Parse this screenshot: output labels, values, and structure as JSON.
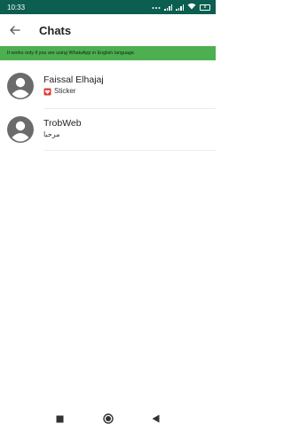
{
  "status_bar": {
    "time": "10:33",
    "battery": "8"
  },
  "header": {
    "title": "Chats",
    "back_icon": "arrow-back-icon"
  },
  "banner": {
    "text": "It works only if you are using WhatsApp in English language."
  },
  "chats": [
    {
      "name": "Faissal Elhajaj",
      "preview": "Sticker",
      "preview_icon": "sticker-icon"
    },
    {
      "name": "TrobWeb",
      "preview": "مرحبا"
    }
  ],
  "nav_bar": {
    "icons": [
      "recents-icon",
      "home-icon",
      "back-icon"
    ]
  },
  "colors": {
    "status_bar": "#0b5e50",
    "banner": "#4caf50",
    "avatar": "#bdbdbd"
  }
}
